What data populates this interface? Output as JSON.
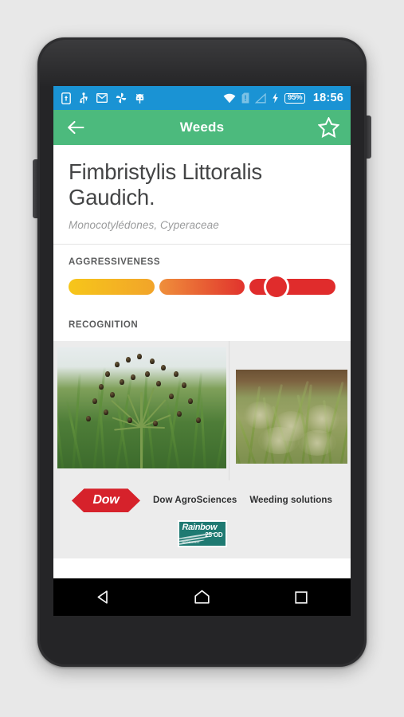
{
  "status_bar": {
    "icons": [
      "sd-card-icon",
      "usb-icon",
      "gmail-icon",
      "pinwheel-icon",
      "android-app-icon"
    ],
    "right_icons": [
      "wifi-icon",
      "sim-card-icon",
      "signal-icon",
      "charging-bolt-icon"
    ],
    "battery_percent": "95%",
    "clock": "18:56",
    "background_color": "#1a93d4"
  },
  "app_bar": {
    "title": "Weeds",
    "back_icon": "arrow-left-icon",
    "favorite_icon": "star-outline-icon",
    "background_color": "#4cba7d"
  },
  "detail": {
    "species_name": "Fimbristylis Littoralis Gaudich.",
    "taxonomy": "Monocotylédones, Cyperaceae"
  },
  "sections": {
    "aggressiveness_label": "AGGRESSIVENESS",
    "recognition_label": "RECOGNITION"
  },
  "aggressiveness": {
    "segments": 3,
    "level": 3,
    "knob_position_percent": 31,
    "colors": {
      "segment_1_start": "#f6c61a",
      "segment_1_end": "#f2a42a",
      "segment_2_start": "#ef8f3b",
      "segment_2_end": "#e1332d",
      "segment_3": "#e02c2c",
      "knob_ring": "#ffffff"
    }
  },
  "recognition": {
    "photos": [
      {
        "name": "sedge-seedhead-photo",
        "alt": "Fimbristylis littoralis seed heads above green grass"
      },
      {
        "name": "grassy-field-photo",
        "alt": "Grassy field infested with weeds"
      }
    ]
  },
  "sponsor": {
    "dow_logo_text": "Dow",
    "dow_name": "Dow AgroSciences",
    "tagline": "Weeding solutions",
    "product_logo": {
      "name": "Rainbow",
      "dose": "25 OD",
      "subtitle": "HERBICIDE"
    },
    "colors": {
      "dow_red": "#d6222b",
      "rainbow_teal": "#1f7a72"
    }
  },
  "nav_bar": {
    "back_icon": "nav-back-triangle-icon",
    "home_icon": "nav-home-icon",
    "recents_icon": "nav-recents-square-icon"
  }
}
